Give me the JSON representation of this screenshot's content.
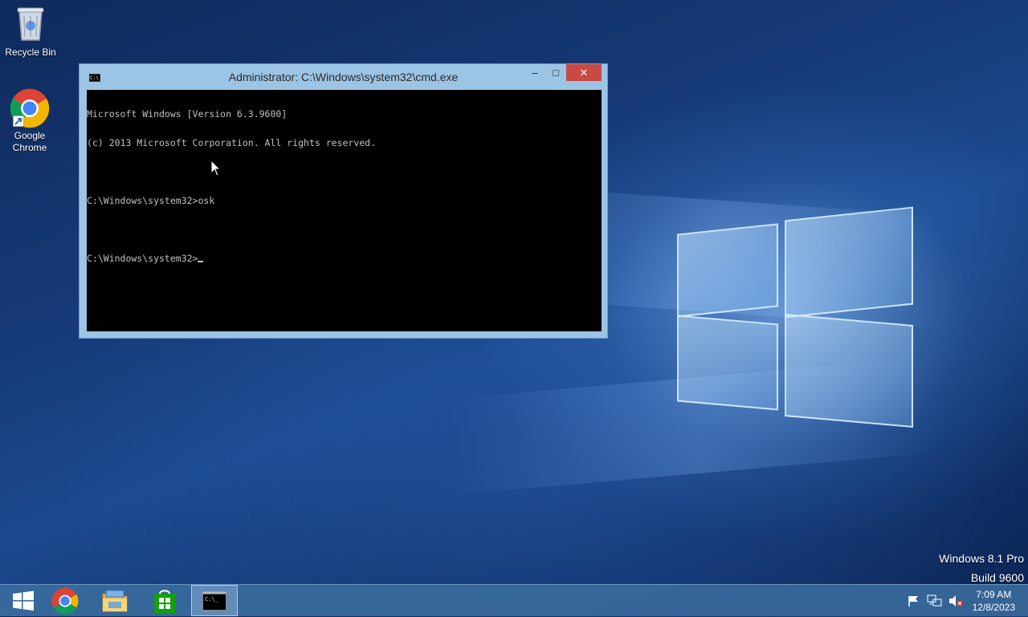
{
  "desktop": {
    "icons": [
      {
        "label": "Recycle Bin",
        "icon": "recycle-bin-icon"
      },
      {
        "label": "Google\nChrome",
        "icon": "chrome-icon"
      }
    ],
    "watermark": {
      "line1": "Windows 8.1 Pro",
      "line2": "Build 9600"
    }
  },
  "cmd_window": {
    "title": "Administrator: C:\\Windows\\system32\\cmd.exe",
    "minimize_glyph": "–",
    "maximize_glyph": "□",
    "close_glyph": "✕",
    "lines": [
      "Microsoft Windows [Version 6.3.9600]",
      "(c) 2013 Microsoft Corporation. All rights reserved.",
      "",
      "C:\\Windows\\system32>osk",
      "",
      "C:\\Windows\\system32>"
    ]
  },
  "taskbar": {
    "items": [
      {
        "icon": "start-windows-icon"
      },
      {
        "icon": "chrome-icon"
      },
      {
        "icon": "file-explorer-icon"
      },
      {
        "icon": "store-icon"
      },
      {
        "icon": "cmd-icon",
        "active": true
      }
    ],
    "tray": {
      "icons": [
        "action-center-flag-icon",
        "network-icon",
        "volume-muted-icon"
      ]
    },
    "clock": {
      "time": "7:09 AM",
      "date": "12/8/2023"
    }
  },
  "colors": {
    "taskbar": "#4b7fae",
    "console_bg": "#000000",
    "console_text": "#c0c0c0",
    "close_button": "#c94a43"
  }
}
